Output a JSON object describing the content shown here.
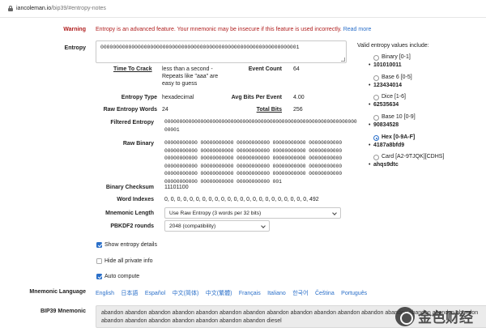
{
  "browser": {
    "url_domain": "iancoleman.io",
    "url_path": "/bip39/#entropy-notes"
  },
  "warning": {
    "label": "Warning",
    "text": "Entropy is an advanced feature. Your mnemonic may be insecure if this feature is used incorrectly.",
    "link": "Read more"
  },
  "entropy": {
    "label": "Entropy",
    "value": "0000000000000000000000000000000000000000000000000000000000000001"
  },
  "details": {
    "time_to_crack_label": "Time To Crack",
    "time_to_crack_value": [
      "less than a second -",
      "Repeats like \"aaa\" are",
      "easy to guess"
    ],
    "event_count_label": "Event Count",
    "event_count_value": "64",
    "entropy_type_label": "Entropy Type",
    "entropy_type_value": "hexadecimal",
    "avg_bits_label": "Avg Bits Per Event",
    "avg_bits_value": "4.00",
    "raw_words_label": "Raw Entropy Words",
    "raw_words_value": "24",
    "total_bits_label": "Total Bits",
    "total_bits_value": "256",
    "filtered_label": "Filtered Entropy",
    "filtered_value": "0000000000000000000000000000000000000000000000000000000000000000\n00001",
    "raw_binary_label": "Raw Binary",
    "raw_binary_value": "00000000000 00000000000 00000000000 00000000000 00000000000\n00000000000 00000000000 00000000000 00000000000 00000000000\n00000000000 00000000000 00000000000 00000000000 00000000000\n00000000000 00000000000 00000000000 00000000000 00000000000\n00000000000 00000000000 00000000000 00000000000 00000000000\n00000000000 00000000000 00000000000 001",
    "checksum_label": "Binary Checksum",
    "checksum_value": "11101100",
    "word_indexes_label": "Word Indexes",
    "word_indexes_value": "0, 0, 0, 0, 0, 0, 0, 0, 0, 0, 0, 0, 0, 0, 0, 0, 0, 0, 0, 0, 0, 0, 0, 492",
    "mnemonic_length_label": "Mnemonic Length",
    "mnemonic_length_value": "Use Raw Entropy (3 words per 32 bits)",
    "pbkdf2_label": "PBKDF2 rounds",
    "pbkdf2_value": "2048 (compatibility)"
  },
  "options": {
    "show_details": "Show entropy details",
    "show_details_checked": true,
    "hide_private": "Hide all private info",
    "hide_private_checked": false,
    "auto_compute": "Auto compute",
    "auto_compute_checked": true
  },
  "language": {
    "label": "Mnemonic Language",
    "options": [
      "English",
      "日本語",
      "Español",
      "中文(简体)",
      "中文(繁體)",
      "Français",
      "Italiano",
      "한국어",
      "Čeština",
      "Português"
    ]
  },
  "mnemonic": {
    "label": "BIP39 Mnemonic",
    "value": "abandon abandon abandon abandon abandon abandon abandon abandon abandon abandon abandon abandon abandon abandon abandon abandon abandon abandon abandon abandon abandon abandon abandon diesel"
  },
  "sidebar": {
    "title": "Valid entropy values include:",
    "options": [
      {
        "label": "Binary [0-1]",
        "example": "101010011",
        "selected": false
      },
      {
        "label": "Base 6 [0-5]",
        "example": "123434014",
        "selected": false
      },
      {
        "label": "Dice [1-6]",
        "example": "62535634",
        "selected": false
      },
      {
        "label": "Base 10 [0-9]",
        "example": "90834528",
        "selected": false
      },
      {
        "label": "Hex [0-9A-F]",
        "example": "4187a8bfd9",
        "selected": true
      },
      {
        "label": "Card [A2-9TJQK][CDHS]",
        "example": "ahqs9dtc",
        "selected": false
      }
    ]
  },
  "watermark": {
    "text": "金色财经"
  }
}
